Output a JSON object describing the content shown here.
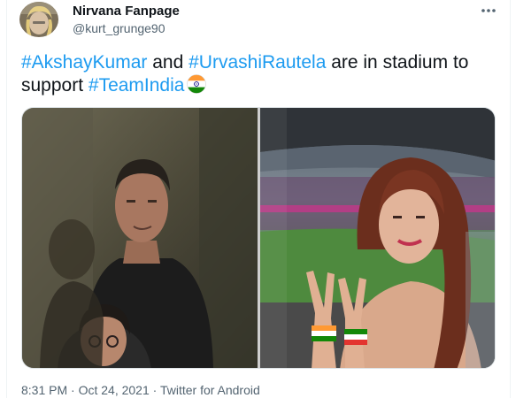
{
  "tweet": {
    "author": {
      "name": "Nirvana Fanpage",
      "handle": "@kurt_grunge90"
    },
    "text": {
      "hashtag_1": "#AkshayKumar",
      "connector_1": " and ",
      "hashtag_2": "#UrvashiRautela",
      "connector_2": " are in stadium to support ",
      "hashtag_3": "#TeamIndia"
    },
    "media": {
      "photo_count": 2
    },
    "meta": {
      "timestamp": "8:31 PM · Oct 24, 2021",
      "separator": " · ",
      "source": "Twitter for Android"
    }
  },
  "icons": {
    "more": "more-options-icon",
    "flag": "indian-flag-emoji"
  },
  "colors": {
    "hashtag": "#1d9bf0",
    "text": "#0f1419",
    "secondary": "#536471"
  }
}
